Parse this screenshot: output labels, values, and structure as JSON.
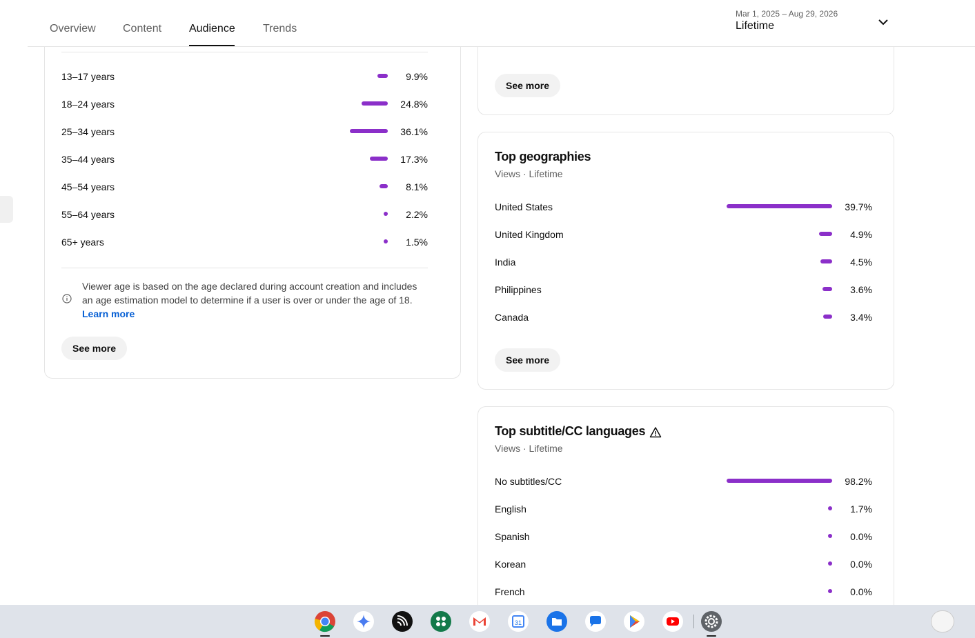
{
  "header": {
    "tabs": [
      {
        "label": "Overview"
      },
      {
        "label": "Content"
      },
      {
        "label": "Audience"
      },
      {
        "label": "Trends"
      }
    ],
    "active_tab": "Audience",
    "date_range": "Mar 1, 2025 – Aug 29, 2026",
    "period": "Lifetime"
  },
  "age_card": {
    "rows": [
      {
        "label": "13–17 years",
        "pct": "9.9%",
        "value": 9.9
      },
      {
        "label": "18–24 years",
        "pct": "24.8%",
        "value": 24.8
      },
      {
        "label": "25–34 years",
        "pct": "36.1%",
        "value": 36.1
      },
      {
        "label": "35–44 years",
        "pct": "17.3%",
        "value": 17.3
      },
      {
        "label": "45–54 years",
        "pct": "8.1%",
        "value": 8.1
      },
      {
        "label": "55–64 years",
        "pct": "2.2%",
        "value": 2.2
      },
      {
        "label": "65+ years",
        "pct": "1.5%",
        "value": 1.5
      }
    ],
    "note": "Viewer age is based on the age declared during account creation and includes an age estimation model to determine if a user is over or under the age of 18.",
    "learn_more": "Learn more",
    "see_more": "See more"
  },
  "top_card": {
    "see_more": "See more"
  },
  "geo_card": {
    "title": "Top geographies",
    "subtitle": "Views · Lifetime",
    "rows": [
      {
        "label": "United States",
        "pct": "39.7%",
        "value": 39.7
      },
      {
        "label": "United Kingdom",
        "pct": "4.9%",
        "value": 4.9
      },
      {
        "label": "India",
        "pct": "4.5%",
        "value": 4.5
      },
      {
        "label": "Philippines",
        "pct": "3.6%",
        "value": 3.6
      },
      {
        "label": "Canada",
        "pct": "3.4%",
        "value": 3.4
      }
    ],
    "see_more": "See more"
  },
  "subtitle_card": {
    "title": "Top subtitle/CC languages",
    "subtitle": "Views · Lifetime",
    "rows": [
      {
        "label": "No subtitles/CC",
        "pct": "98.2%",
        "value": 98.2
      },
      {
        "label": "English",
        "pct": "1.7%",
        "value": 1.7
      },
      {
        "label": "Spanish",
        "pct": "0.0%",
        "value": 0.0
      },
      {
        "label": "Korean",
        "pct": "0.0%",
        "value": 0.0
      },
      {
        "label": "French",
        "pct": "0.0%",
        "value": 0.0
      }
    ]
  },
  "colors": {
    "bar": "#8b2fc9",
    "link": "#065fd4"
  },
  "shelf": {
    "apps": [
      {
        "name": "chrome-icon"
      },
      {
        "name": "gemini-icon"
      },
      {
        "name": "cast-app-icon"
      },
      {
        "name": "launcher-apps-icon"
      },
      {
        "name": "gmail-icon"
      },
      {
        "name": "calendar-icon",
        "text": "31"
      },
      {
        "name": "files-icon"
      },
      {
        "name": "messages-icon"
      },
      {
        "name": "play-store-icon"
      },
      {
        "name": "youtube-icon"
      },
      {
        "name": "settings-icon"
      }
    ]
  }
}
